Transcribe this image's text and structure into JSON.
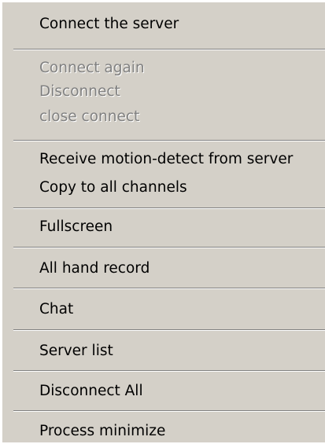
{
  "menu": {
    "items": [
      {
        "label": "Connect the server",
        "enabled": true
      },
      {
        "label": "Connect again",
        "enabled": false
      },
      {
        "label": "Disconnect",
        "enabled": false
      },
      {
        "label": "close connect",
        "enabled": false
      },
      {
        "label": "Receive motion-detect from server",
        "enabled": true
      },
      {
        "label": "Copy to all channels",
        "enabled": true
      },
      {
        "label": "Fullscreen",
        "enabled": true
      },
      {
        "label": "All hand record",
        "enabled": true
      },
      {
        "label": "Chat",
        "enabled": true
      },
      {
        "label": "Server list",
        "enabled": true
      },
      {
        "label": "Disconnect All",
        "enabled": true
      },
      {
        "label": "Process minimize",
        "enabled": true
      }
    ],
    "colors": {
      "background": "#d4d0c8",
      "text": "#000000",
      "disabled_text": "#808080",
      "separator_shadow": "#808080",
      "separator_highlight": "#ffffff"
    }
  }
}
